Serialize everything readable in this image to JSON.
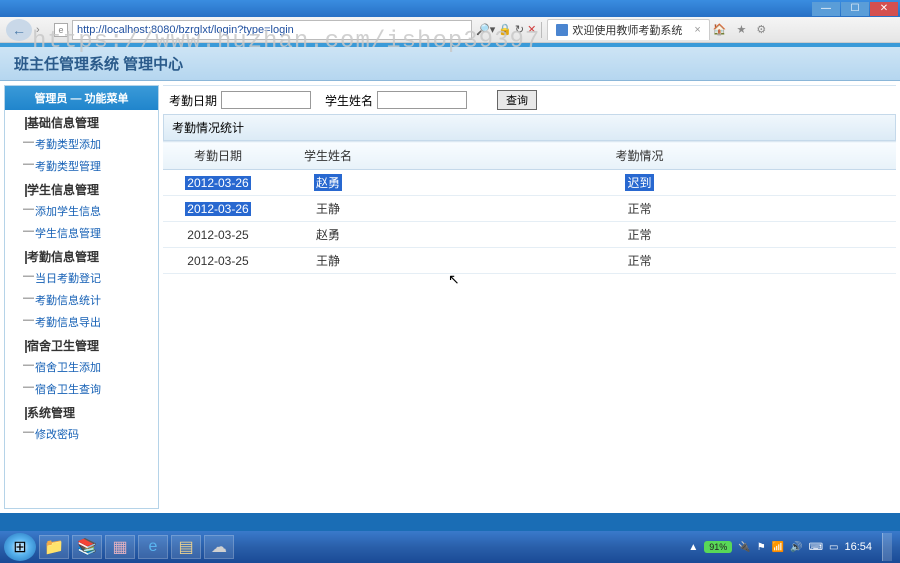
{
  "browser": {
    "url": "http://localhost:8080/bzrglxt/login?type=login",
    "tab_title": "欢迎使用教师考勤系统",
    "chrome_icons": [
      "🏠",
      "★",
      "⚙"
    ]
  },
  "watermark": "https://www.huzhan.com/ishop39397",
  "app": {
    "title": "班主任管理系统 管理中心"
  },
  "sidebar": {
    "header": "管理员 — 功能菜单",
    "groups": [
      {
        "label": "基础信息管理",
        "items": [
          "考勤类型添加",
          "考勤类型管理"
        ]
      },
      {
        "label": "学生信息管理",
        "items": [
          "添加学生信息",
          "学生信息管理"
        ]
      },
      {
        "label": "考勤信息管理",
        "items": [
          "当日考勤登记",
          "考勤信息统计",
          "考勤信息导出"
        ]
      },
      {
        "label": "宿舍卫生管理",
        "items": [
          "宿舍卫生添加",
          "宿舍卫生查询"
        ]
      },
      {
        "label": "系统管理",
        "items": [
          "修改密码"
        ]
      }
    ]
  },
  "filter": {
    "date_label": "考勤日期",
    "name_label": "学生姓名",
    "search_btn": "查询"
  },
  "table": {
    "title": "考勤情况统计",
    "headers": [
      "考勤日期",
      "学生姓名",
      "考勤情况"
    ],
    "rows": [
      {
        "date": "2012-03-26",
        "name": "赵勇",
        "status": "迟到",
        "sel": true
      },
      {
        "date": "2012-03-26",
        "name": "王静",
        "status": "正常",
        "sel": false,
        "sel_date": true
      },
      {
        "date": "2012-03-25",
        "name": "赵勇",
        "status": "正常",
        "sel": false
      },
      {
        "date": "2012-03-25",
        "name": "王静",
        "status": "正常",
        "sel": false
      }
    ]
  },
  "taskbar": {
    "battery": "91%",
    "clock": "16:54"
  }
}
